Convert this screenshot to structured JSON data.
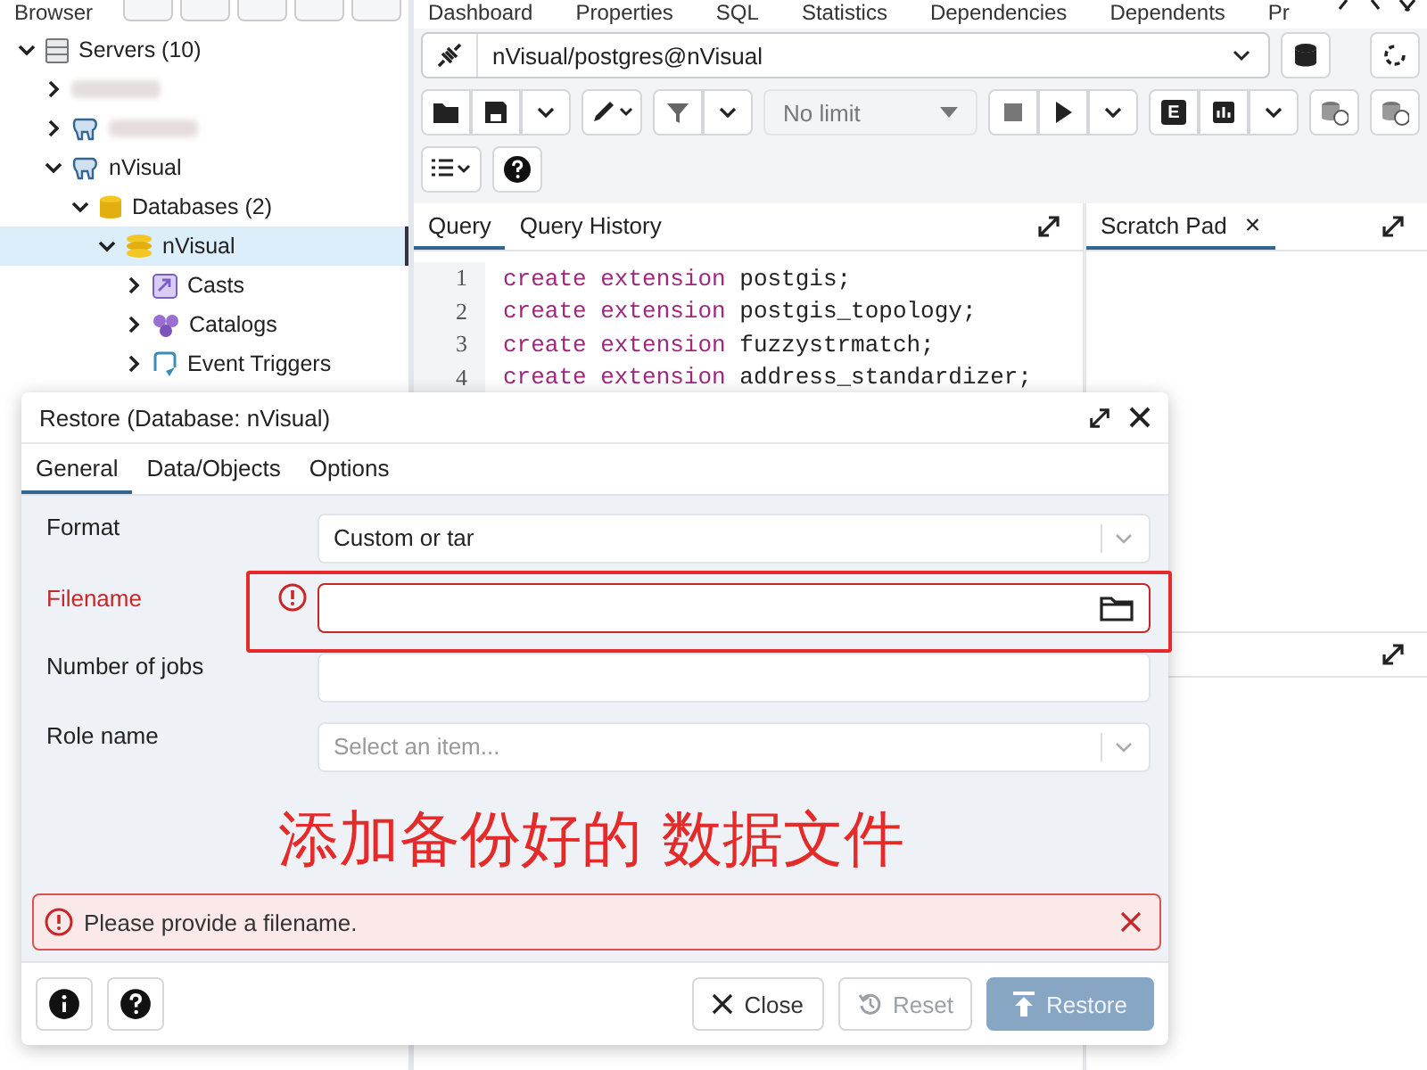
{
  "main_tabs": {
    "browser_title": "Browser",
    "panel_tabs": [
      "Dashboard",
      "Properties",
      "SQL",
      "Statistics",
      "Dependencies",
      "Dependents",
      "Pr"
    ]
  },
  "tree": [
    {
      "label": "Servers (10)",
      "kind": "servers",
      "expanded": true,
      "selected": false,
      "children": [
        {
          "kind": "hidden",
          "expanded": false,
          "selected": false
        },
        {
          "kind": "hidden-server",
          "expanded": false,
          "selected": false
        },
        {
          "label": "nVisual",
          "kind": "server",
          "expanded": true,
          "selected": false,
          "children": [
            {
              "label": "Databases (2)",
              "kind": "databases",
              "expanded": true,
              "selected": false,
              "children": [
                {
                  "label": "nVisual",
                  "kind": "database",
                  "expanded": true,
                  "selected": true,
                  "children": [
                    {
                      "label": "Casts",
                      "kind": "casts",
                      "expanded": false,
                      "selected": false
                    },
                    {
                      "label": "Catalogs",
                      "kind": "catalogs",
                      "expanded": false,
                      "selected": false
                    },
                    {
                      "label": "Event Triggers",
                      "kind": "triggers",
                      "expanded": false,
                      "selected": false
                    }
                  ]
                }
              ]
            }
          ]
        }
      ]
    }
  ],
  "connection": {
    "value": "nVisual/postgres@nVisual"
  },
  "toolbar": {
    "limit": "No limit",
    "explain": "E"
  },
  "query_tabs": [
    {
      "label": "Query",
      "selected": true
    },
    {
      "label": "Query History",
      "selected": false
    }
  ],
  "scratch_tab": {
    "label": "Scratch Pad",
    "close": "×"
  },
  "code_lines": [
    {
      "number": "1",
      "keyword": "create extension",
      "text": "postgis;"
    },
    {
      "number": "2",
      "keyword": "create extension",
      "text": "postgis_topology;"
    },
    {
      "number": "3",
      "keyword": "create extension",
      "text": "fuzzystrmatch;"
    },
    {
      "number": "4",
      "keyword": "create extension",
      "text": "address_standardizer;"
    }
  ],
  "dialog": {
    "title": "Restore (Database: nVisual)",
    "tabs": [
      {
        "label": "General",
        "selected": true
      },
      {
        "label": "Data/Objects",
        "selected": false
      },
      {
        "label": "Options",
        "selected": false
      }
    ],
    "fields": [
      {
        "label": "Format",
        "kind": "select",
        "value": "Custom or tar",
        "error": false
      },
      {
        "label": "Filename",
        "kind": "file",
        "error": true
      },
      {
        "label": "Number of jobs",
        "kind": "text",
        "error": false
      },
      {
        "label": "Role name",
        "kind": "select",
        "placeholder": "Select an item...",
        "error": false
      }
    ],
    "annotation": "添加备份好的 数据文件",
    "error_message": "Please provide a filename.",
    "buttons": [
      {
        "label": "Close",
        "kind": "close",
        "disabled": false
      },
      {
        "label": "Reset",
        "kind": "reset",
        "disabled": true
      },
      {
        "label": "Restore",
        "kind": "restore",
        "disabled": true
      }
    ]
  }
}
